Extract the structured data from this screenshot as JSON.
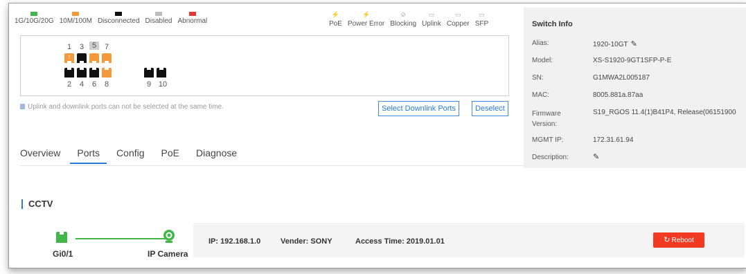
{
  "legend_left": [
    {
      "label": "1G/10G/20G",
      "color": "#43b649"
    },
    {
      "label": "10M/100M",
      "color": "#f59a3a"
    },
    {
      "label": "Disconnected",
      "color": "#111111"
    },
    {
      "label": "Disabled",
      "color": "#bdbdbd"
    },
    {
      "label": "Abnormal",
      "color": "#e53935"
    }
  ],
  "legend_right": [
    {
      "label": "PoE",
      "icon": "poe-icon"
    },
    {
      "label": "Power Error",
      "icon": "power-error-icon"
    },
    {
      "label": "Blocking",
      "icon": "blocking-icon"
    },
    {
      "label": "Uplink",
      "icon": "uplink-icon"
    },
    {
      "label": "Copper",
      "icon": "copper-icon"
    },
    {
      "label": "SFP",
      "icon": "sfp-icon"
    }
  ],
  "ports": {
    "top_numbers": [
      "1",
      "3",
      "5",
      "7"
    ],
    "bottom_numbers": [
      "2",
      "4",
      "6",
      "8",
      "9",
      "10"
    ]
  },
  "hint": "Uplink and downlink ports can not be selected at the same time.",
  "buttons": {
    "select_downlink": "Select Downlink Ports",
    "deselect": "Deselect"
  },
  "tabs": [
    {
      "label": "Overview",
      "active": false
    },
    {
      "label": "Ports",
      "active": true
    },
    {
      "label": "Config",
      "active": false
    },
    {
      "label": "PoE",
      "active": false
    },
    {
      "label": "Diagnose",
      "active": false
    }
  ],
  "switch_info": {
    "title": "Switch Info",
    "alias_label": "Alias:",
    "alias": "1920-10GT",
    "model_label": "Model:",
    "model": "XS-S1920-9GT1SFP-P-E",
    "sn_label": "SN:",
    "sn": "G1MWA2L005187",
    "mac_label": "MAC:",
    "mac": "8005.881a.87aa",
    "firmware_label": "Firmware Version:",
    "firmware": "S19_RGOS 11.4(1)B41P4, Release(06151900",
    "mgmt_ip_label": "MGMT IP:",
    "mgmt_ip": "172.31.61.94",
    "description_label": "Description:"
  },
  "cctv": {
    "title": "CCTV",
    "port_label": "Gi0/1",
    "device_label": "IP Camera",
    "ip": "IP: 192.168.1.0",
    "vender": "Vender: SONY",
    "access_time": "Access Time: 2019.01.01",
    "reboot": "Reboot"
  },
  "colors": {
    "accent": "#2a7bd8",
    "online": "#43b649",
    "orange": "#f59a3a",
    "danger": "#f23a22"
  }
}
